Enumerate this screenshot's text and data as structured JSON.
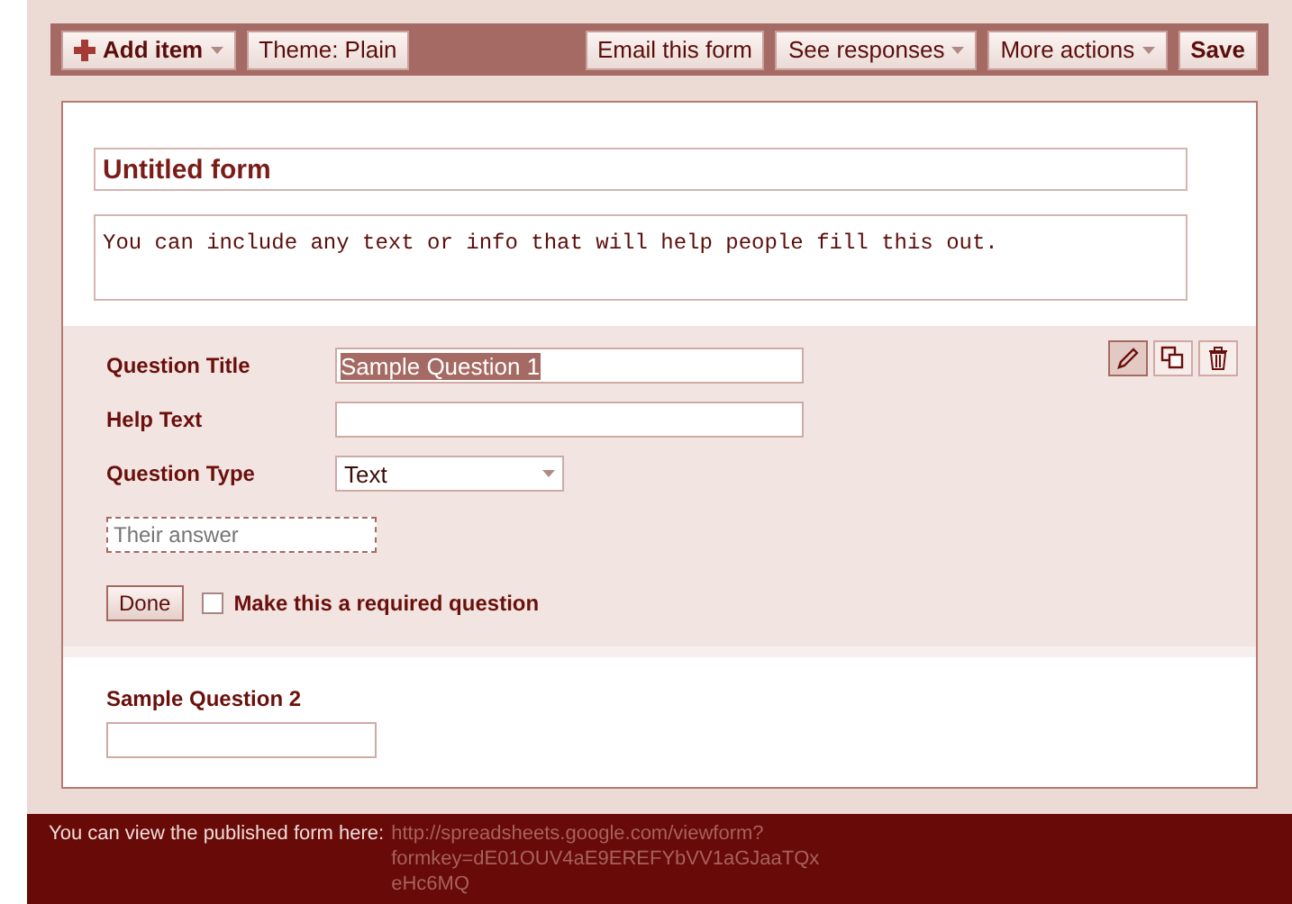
{
  "toolbar": {
    "left": [
      {
        "label": "Add item",
        "kind": "add",
        "menu": true
      },
      {
        "label": "Theme:  Plain",
        "kind": "plain",
        "menu": false
      }
    ],
    "right": [
      {
        "label": "Email this form",
        "kind": "plain",
        "menu": false
      },
      {
        "label": "See responses",
        "kind": "plain",
        "menu": true
      },
      {
        "label": "More actions",
        "kind": "plain",
        "menu": true
      },
      {
        "label": "Save",
        "kind": "bold",
        "menu": false
      }
    ]
  },
  "form": {
    "title": "Untitled form",
    "description": "You can include any text or info that will help people fill this out."
  },
  "editing_question": {
    "fields": [
      {
        "label": "Question Title",
        "kind": "text",
        "value": "Sample Question 1",
        "highlighted": true
      },
      {
        "label": "Help Text",
        "kind": "text"
      },
      {
        "label": "Question Type",
        "kind": "select",
        "value": "Text"
      }
    ],
    "tools": [
      {
        "kind": "edit",
        "selected": true
      },
      {
        "kind": "copy",
        "selected": false
      },
      {
        "kind": "delete",
        "selected": false
      }
    ],
    "preview_placeholder": "Their answer",
    "done": "Done",
    "required": {
      "label": "Make this a required question",
      "checked": false
    }
  },
  "questions": [
    {
      "title": "Sample Question 2"
    }
  ],
  "footer": {
    "text": "You can view the published form here:",
    "link": "http://spreadsheets.google.com/viewform?formkey=dE01OUV4aE9EREFYbVV1aGJaaTQxeHc6MQ"
  }
}
